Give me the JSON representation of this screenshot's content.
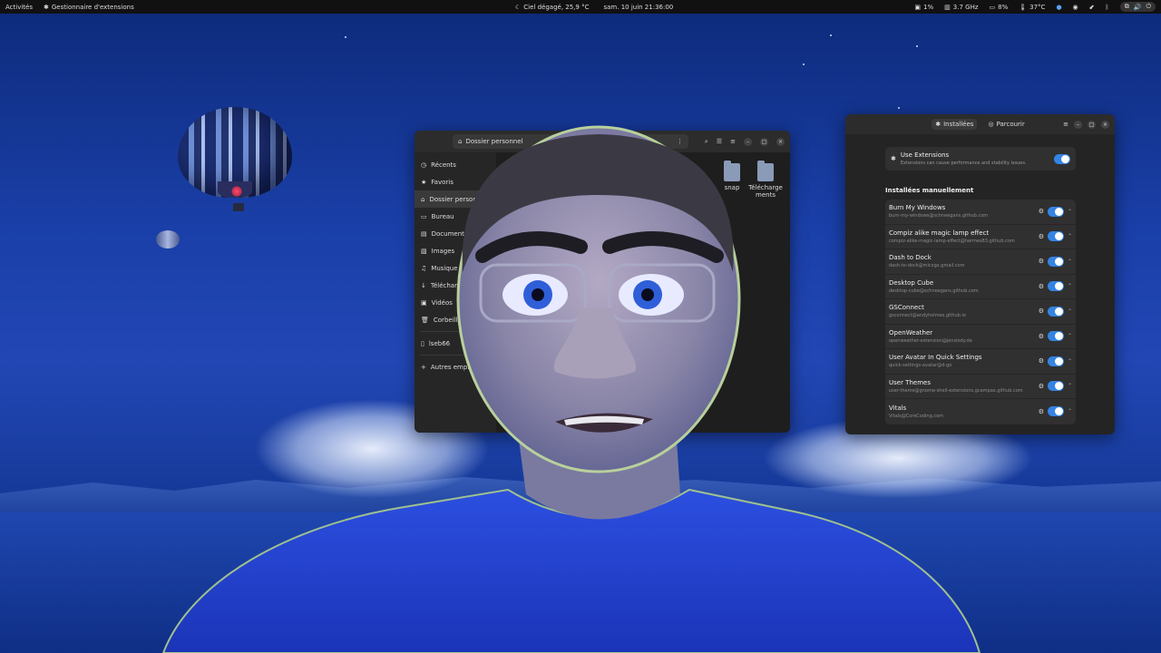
{
  "topbar": {
    "activities": "Activités",
    "app_name": "Gestionnaire d'extensions",
    "weather": "Ciel dégagé, 25,9 °C",
    "datetime": "sam. 10 juin  21:36:00",
    "cpu": "1%",
    "freq": "3.7 GHz",
    "mem": "8%",
    "temp": "37°C"
  },
  "file_manager": {
    "path": "Dossier personnel",
    "sidebar": [
      {
        "icon": "clock-icon",
        "glyph": "◷",
        "label": "Récents"
      },
      {
        "icon": "star-icon",
        "glyph": "★",
        "label": "Favoris"
      },
      {
        "icon": "home-icon",
        "glyph": "⌂",
        "label": "Dossier personnel",
        "active": true
      },
      {
        "icon": "desktop-icon",
        "glyph": "▭",
        "label": "Bureau"
      },
      {
        "icon": "document-icon",
        "glyph": "▤",
        "label": "Documents"
      },
      {
        "icon": "image-icon",
        "glyph": "▧",
        "label": "Images"
      },
      {
        "icon": "music-icon",
        "glyph": "♫",
        "label": "Musique"
      },
      {
        "icon": "download-icon",
        "glyph": "↓",
        "label": "Téléchargements"
      },
      {
        "icon": "video-icon",
        "glyph": "▣",
        "label": "Vidéos"
      },
      {
        "icon": "trash-icon",
        "glyph": "🗑",
        "label": "Corbeille"
      },
      {
        "icon": "drive-icon",
        "glyph": "▯",
        "label": "lseb66"
      },
      {
        "icon": "plus-icon",
        "glyph": "+",
        "label": "Autres emplacements"
      }
    ],
    "folders": [
      {
        "label": "snap"
      },
      {
        "label": "Télécharge ments"
      }
    ]
  },
  "extension_manager": {
    "tabs": [
      {
        "label": "Installées",
        "active": true
      },
      {
        "label": "Parcourir",
        "active": false
      }
    ],
    "use_extensions": {
      "title": "Use Extensions",
      "subtitle": "Extensions can cause performance and stability issues.",
      "enabled": true
    },
    "section_title": "Installées manuellement",
    "extensions": [
      {
        "name": "Burn My Windows",
        "id": "burn-my-windows@schneegans.github.com",
        "enabled": true
      },
      {
        "name": "Compiz alike magic lamp effect",
        "id": "compiz-alike-magic-lamp-effect@hermes83.github.com",
        "enabled": true
      },
      {
        "name": "Dash to Dock",
        "id": "dash-to-dock@micxgx.gmail.com",
        "enabled": true
      },
      {
        "name": "Desktop Cube",
        "id": "desktop-cube@schneegans.github.com",
        "enabled": true
      },
      {
        "name": "GSConnect",
        "id": "gsconnect@andyholmes.github.io",
        "enabled": true
      },
      {
        "name": "OpenWeather",
        "id": "openweather-extension@jenslody.de",
        "enabled": true
      },
      {
        "name": "User Avatar In Quick Settings",
        "id": "quick-settings-avatar@d-go",
        "enabled": true
      },
      {
        "name": "User Themes",
        "id": "user-theme@gnome-shell-extensions.gcampax.github.com",
        "enabled": true
      },
      {
        "name": "Vitals",
        "id": "Vitals@CoreCoding.com",
        "enabled": true
      }
    ]
  },
  "colors": {
    "accent": "#3584e4",
    "wallpaper_top": "#0d2a7a",
    "wallpaper_mid": "#2247b5"
  }
}
